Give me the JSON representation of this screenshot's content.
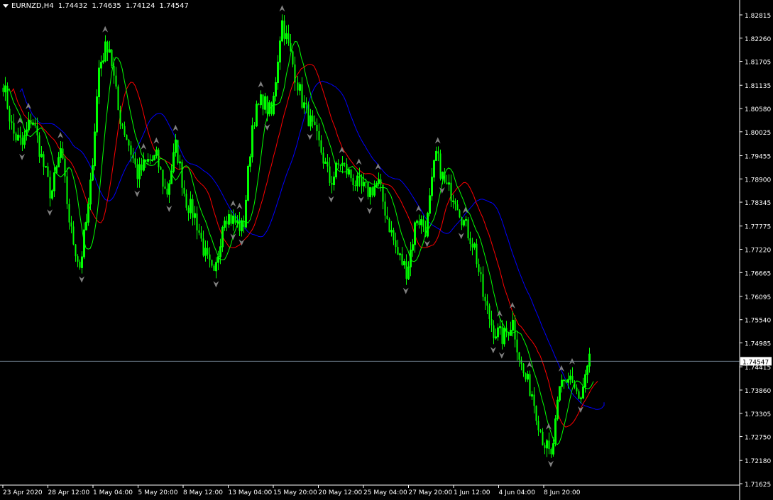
{
  "header": {
    "symbol_tf": "EURNZD,H4",
    "open": "1.74432",
    "high": "1.74635",
    "low": "1.74124",
    "close": "1.74547"
  },
  "colors": {
    "background": "#000000",
    "bull_candle": "#00ff00",
    "bear_candle": "#00ff00",
    "ma_fast": "#00ff00",
    "ma_mid": "#ff0000",
    "ma_slow": "#0000ff",
    "fractal": "#808080",
    "bid_line": "#708090",
    "text": "#ffffff"
  },
  "chart_data": {
    "type": "line",
    "title": "EURNZD,H4",
    "ylim": [
      1.71625,
      1.82815
    ],
    "price_ticks": [
      "1.82815",
      "1.82260",
      "1.81705",
      "1.81135",
      "1.80580",
      "1.80025",
      "1.79455",
      "1.78900",
      "1.78345",
      "1.77775",
      "1.77220",
      "1.76665",
      "1.76095",
      "1.75540",
      "1.74985",
      "1.74415",
      "1.73860",
      "1.73305",
      "1.72750",
      "1.72180",
      "1.71625"
    ],
    "time_labels": [
      "23 Apr 2020",
      "28 Apr 12:00",
      "1 May 04:00",
      "5 May 20:00",
      "8 May 12:00",
      "13 May 04:00",
      "15 May 20:00",
      "20 May 12:00",
      "25 May 04:00",
      "27 May 20:00",
      "1 Jun 12:00",
      "4 Jun 04:00",
      "8 Jun 20:00"
    ],
    "last_price": "1.74547",
    "close_path": [
      1.812,
      1.8,
      1.797,
      1.804,
      1.794,
      1.785,
      1.796,
      1.777,
      1.768,
      1.784,
      1.816,
      1.822,
      1.805,
      1.798,
      1.79,
      1.793,
      1.794,
      1.785,
      1.797,
      1.784,
      1.78,
      1.771,
      1.765,
      1.781,
      1.779,
      1.777,
      1.803,
      1.808,
      1.804,
      1.827,
      1.818,
      1.808,
      1.802,
      1.796,
      1.788,
      1.793,
      1.79,
      1.787,
      1.786,
      1.788,
      1.779,
      1.771,
      1.767,
      1.78,
      1.777,
      1.795,
      1.787,
      1.785,
      1.778,
      1.773,
      1.76,
      1.753,
      1.751,
      1.755,
      1.743,
      1.738,
      1.728,
      1.722,
      1.74,
      1.742,
      1.735,
      1.745
    ]
  }
}
